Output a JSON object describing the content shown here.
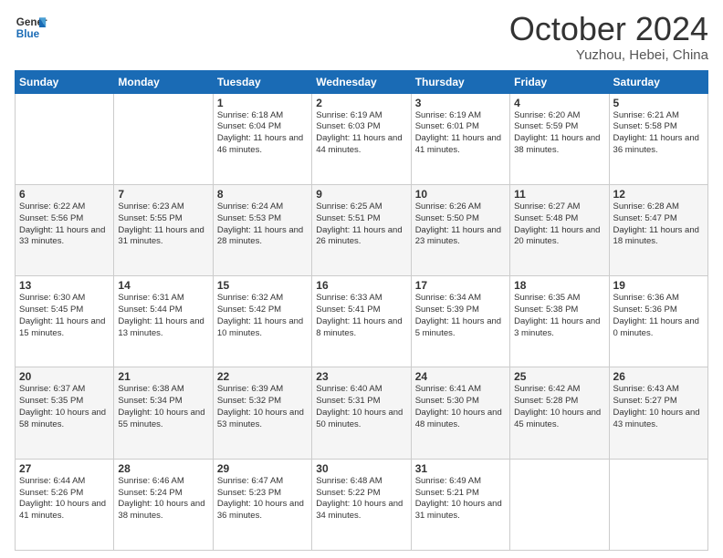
{
  "header": {
    "logo_general": "General",
    "logo_blue": "Blue",
    "month_title": "October 2024",
    "location": "Yuzhou, Hebei, China"
  },
  "days_of_week": [
    "Sunday",
    "Monday",
    "Tuesday",
    "Wednesday",
    "Thursday",
    "Friday",
    "Saturday"
  ],
  "weeks": [
    [
      {
        "day": "",
        "content": ""
      },
      {
        "day": "",
        "content": ""
      },
      {
        "day": "1",
        "content": "Sunrise: 6:18 AM\nSunset: 6:04 PM\nDaylight: 11 hours and 46 minutes."
      },
      {
        "day": "2",
        "content": "Sunrise: 6:19 AM\nSunset: 6:03 PM\nDaylight: 11 hours and 44 minutes."
      },
      {
        "day": "3",
        "content": "Sunrise: 6:19 AM\nSunset: 6:01 PM\nDaylight: 11 hours and 41 minutes."
      },
      {
        "day": "4",
        "content": "Sunrise: 6:20 AM\nSunset: 5:59 PM\nDaylight: 11 hours and 38 minutes."
      },
      {
        "day": "5",
        "content": "Sunrise: 6:21 AM\nSunset: 5:58 PM\nDaylight: 11 hours and 36 minutes."
      }
    ],
    [
      {
        "day": "6",
        "content": "Sunrise: 6:22 AM\nSunset: 5:56 PM\nDaylight: 11 hours and 33 minutes."
      },
      {
        "day": "7",
        "content": "Sunrise: 6:23 AM\nSunset: 5:55 PM\nDaylight: 11 hours and 31 minutes."
      },
      {
        "day": "8",
        "content": "Sunrise: 6:24 AM\nSunset: 5:53 PM\nDaylight: 11 hours and 28 minutes."
      },
      {
        "day": "9",
        "content": "Sunrise: 6:25 AM\nSunset: 5:51 PM\nDaylight: 11 hours and 26 minutes."
      },
      {
        "day": "10",
        "content": "Sunrise: 6:26 AM\nSunset: 5:50 PM\nDaylight: 11 hours and 23 minutes."
      },
      {
        "day": "11",
        "content": "Sunrise: 6:27 AM\nSunset: 5:48 PM\nDaylight: 11 hours and 20 minutes."
      },
      {
        "day": "12",
        "content": "Sunrise: 6:28 AM\nSunset: 5:47 PM\nDaylight: 11 hours and 18 minutes."
      }
    ],
    [
      {
        "day": "13",
        "content": "Sunrise: 6:30 AM\nSunset: 5:45 PM\nDaylight: 11 hours and 15 minutes."
      },
      {
        "day": "14",
        "content": "Sunrise: 6:31 AM\nSunset: 5:44 PM\nDaylight: 11 hours and 13 minutes."
      },
      {
        "day": "15",
        "content": "Sunrise: 6:32 AM\nSunset: 5:42 PM\nDaylight: 11 hours and 10 minutes."
      },
      {
        "day": "16",
        "content": "Sunrise: 6:33 AM\nSunset: 5:41 PM\nDaylight: 11 hours and 8 minutes."
      },
      {
        "day": "17",
        "content": "Sunrise: 6:34 AM\nSunset: 5:39 PM\nDaylight: 11 hours and 5 minutes."
      },
      {
        "day": "18",
        "content": "Sunrise: 6:35 AM\nSunset: 5:38 PM\nDaylight: 11 hours and 3 minutes."
      },
      {
        "day": "19",
        "content": "Sunrise: 6:36 AM\nSunset: 5:36 PM\nDaylight: 11 hours and 0 minutes."
      }
    ],
    [
      {
        "day": "20",
        "content": "Sunrise: 6:37 AM\nSunset: 5:35 PM\nDaylight: 10 hours and 58 minutes."
      },
      {
        "day": "21",
        "content": "Sunrise: 6:38 AM\nSunset: 5:34 PM\nDaylight: 10 hours and 55 minutes."
      },
      {
        "day": "22",
        "content": "Sunrise: 6:39 AM\nSunset: 5:32 PM\nDaylight: 10 hours and 53 minutes."
      },
      {
        "day": "23",
        "content": "Sunrise: 6:40 AM\nSunset: 5:31 PM\nDaylight: 10 hours and 50 minutes."
      },
      {
        "day": "24",
        "content": "Sunrise: 6:41 AM\nSunset: 5:30 PM\nDaylight: 10 hours and 48 minutes."
      },
      {
        "day": "25",
        "content": "Sunrise: 6:42 AM\nSunset: 5:28 PM\nDaylight: 10 hours and 45 minutes."
      },
      {
        "day": "26",
        "content": "Sunrise: 6:43 AM\nSunset: 5:27 PM\nDaylight: 10 hours and 43 minutes."
      }
    ],
    [
      {
        "day": "27",
        "content": "Sunrise: 6:44 AM\nSunset: 5:26 PM\nDaylight: 10 hours and 41 minutes."
      },
      {
        "day": "28",
        "content": "Sunrise: 6:46 AM\nSunset: 5:24 PM\nDaylight: 10 hours and 38 minutes."
      },
      {
        "day": "29",
        "content": "Sunrise: 6:47 AM\nSunset: 5:23 PM\nDaylight: 10 hours and 36 minutes."
      },
      {
        "day": "30",
        "content": "Sunrise: 6:48 AM\nSunset: 5:22 PM\nDaylight: 10 hours and 34 minutes."
      },
      {
        "day": "31",
        "content": "Sunrise: 6:49 AM\nSunset: 5:21 PM\nDaylight: 10 hours and 31 minutes."
      },
      {
        "day": "",
        "content": ""
      },
      {
        "day": "",
        "content": ""
      }
    ]
  ]
}
